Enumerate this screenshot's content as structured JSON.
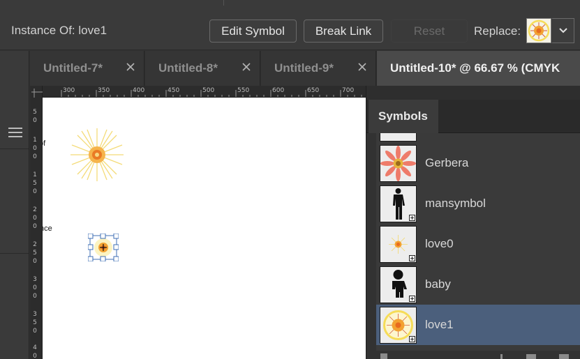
{
  "control_bar": {
    "instance_label": "Instance Of: love1",
    "edit_symbol_label": "Edit Symbol",
    "break_link_label": "Break Link",
    "reset_label": "Reset",
    "replace_label": "Replace:"
  },
  "tabs": [
    {
      "label": "Untitled-7*",
      "active": false
    },
    {
      "label": "Untitled-8*",
      "active": false
    },
    {
      "label": "Untitled-9*",
      "active": false
    },
    {
      "label": "Untitled-10* @ 66.67 % (CMYK",
      "active": true
    }
  ],
  "ruler": {
    "top_labels": [
      "300",
      "350",
      "400",
      "450",
      "500",
      "550",
      "600",
      "650",
      "700"
    ],
    "left_labels": [
      [
        "5",
        "0"
      ],
      [
        "1",
        "0",
        "0"
      ],
      [
        "1",
        "5",
        "0"
      ],
      [
        "2",
        "0",
        "0"
      ],
      [
        "2",
        "5",
        "0"
      ],
      [
        "3",
        "0",
        "0"
      ],
      [
        "3",
        "5",
        "0"
      ],
      [
        "4",
        "0"
      ]
    ]
  },
  "canvas": {
    "text_fragments": [
      "of",
      "nce"
    ]
  },
  "symbols_panel": {
    "title": "Symbols",
    "items": [
      {
        "name": "Gerbera",
        "selected": false
      },
      {
        "name": "mansymbol",
        "selected": false
      },
      {
        "name": "love0",
        "selected": false
      },
      {
        "name": "baby",
        "selected": false
      },
      {
        "name": "love1",
        "selected": true
      }
    ]
  },
  "colors": {
    "accent_selected": "#4b5f7c",
    "flower_orange": "#f08a2a",
    "flower_yellow": "#f7e27a",
    "gerbera_pink": "#ee7b6a"
  }
}
